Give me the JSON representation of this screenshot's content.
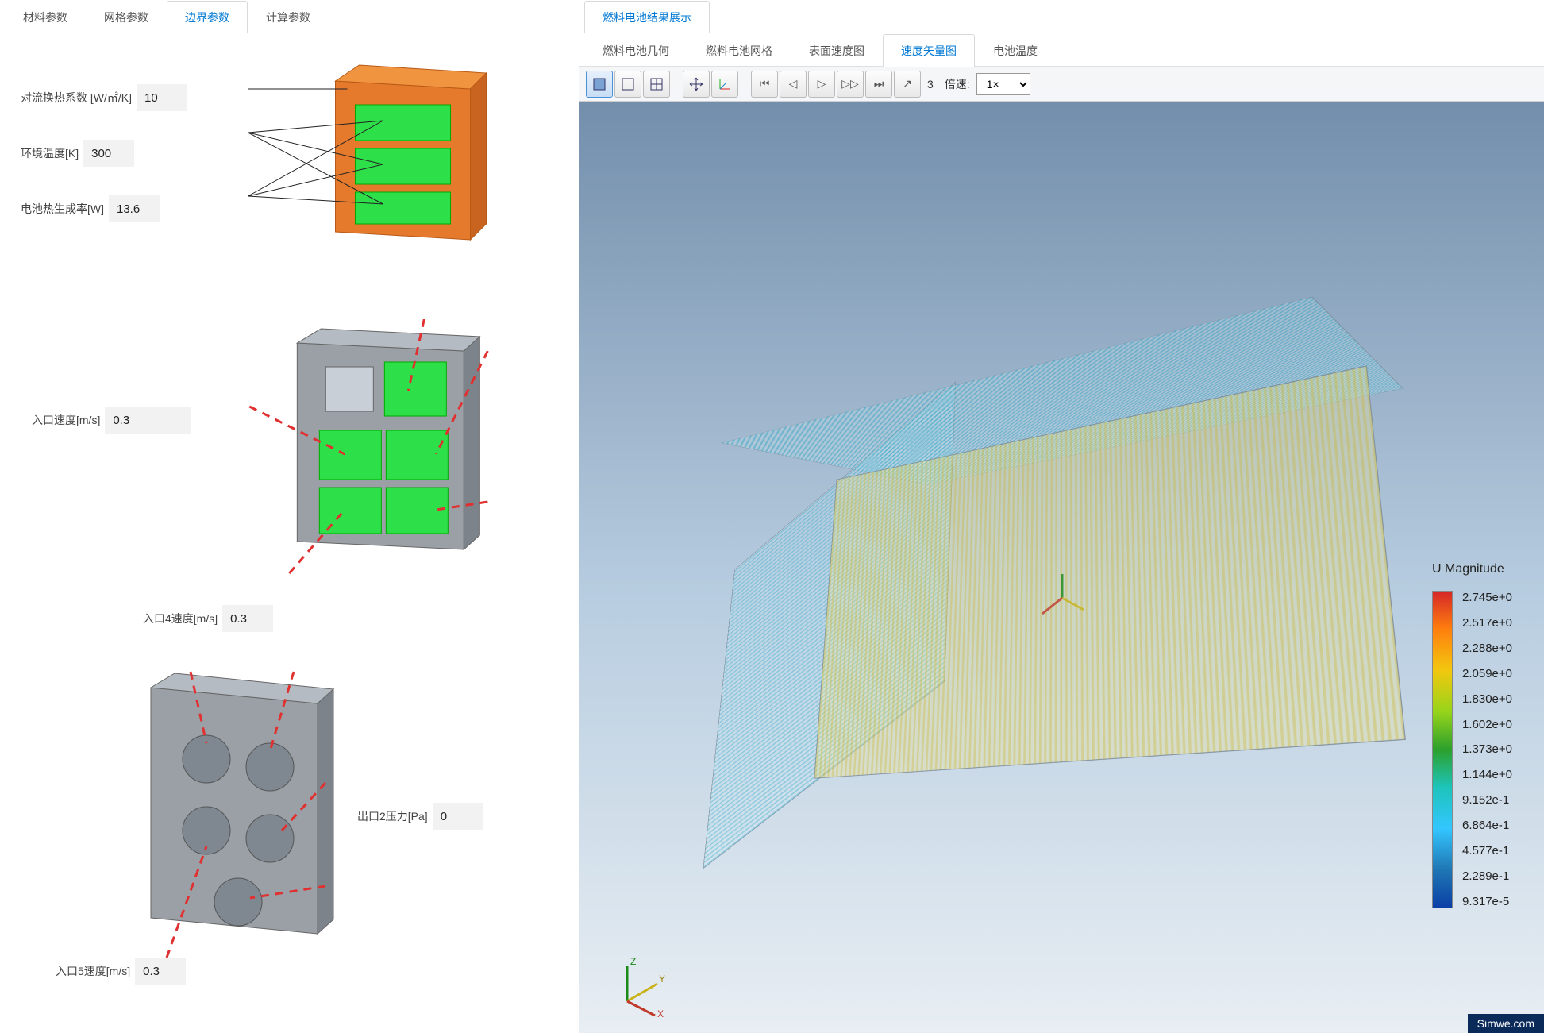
{
  "left": {
    "tabs": [
      {
        "label": "材料参数"
      },
      {
        "label": "网格参数"
      },
      {
        "label": "边界参数",
        "active": true
      },
      {
        "label": "计算参数"
      }
    ],
    "fields": {
      "conv_coef": {
        "label": "对流换热系数 [W/㎡/K]",
        "value": "10"
      },
      "env_temp": {
        "label": "环境温度[K]",
        "value": "300"
      },
      "cell_heat": {
        "label": "电池热生成率[W]",
        "value": "13.6"
      },
      "inlet_vel": {
        "label": "入口速度[m/s]",
        "value": "0.3"
      },
      "inlet4_vel": {
        "label": "入口4速度[m/s]",
        "value": "0.3"
      },
      "outlet2_p": {
        "label": "出口2压力[Pa]",
        "value": "0"
      },
      "inlet5_vel": {
        "label": "入口5速度[m/s]",
        "value": "0.3"
      }
    }
  },
  "right": {
    "tabs_top": [
      {
        "label": "燃料电池结果展示",
        "active": true
      }
    ],
    "tabs_sub": [
      {
        "label": "燃料电池几何"
      },
      {
        "label": "燃料电池网格"
      },
      {
        "label": "表面速度图"
      },
      {
        "label": "速度矢量图",
        "active": true
      },
      {
        "label": "电池温度"
      }
    ],
    "toolbar": {
      "frame": "3",
      "speed_label": "倍速:",
      "speed_value": "1×"
    },
    "legend": {
      "title": "U Magnitude",
      "ticks": [
        "2.745e+0",
        "2.517e+0",
        "2.288e+0",
        "2.059e+0",
        "1.830e+0",
        "1.602e+0",
        "1.373e+0",
        "1.144e+0",
        "9.152e-1",
        "6.864e-1",
        "4.577e-1",
        "2.289e-1",
        "9.317e-5"
      ]
    },
    "watermark": "Simwe.com"
  }
}
